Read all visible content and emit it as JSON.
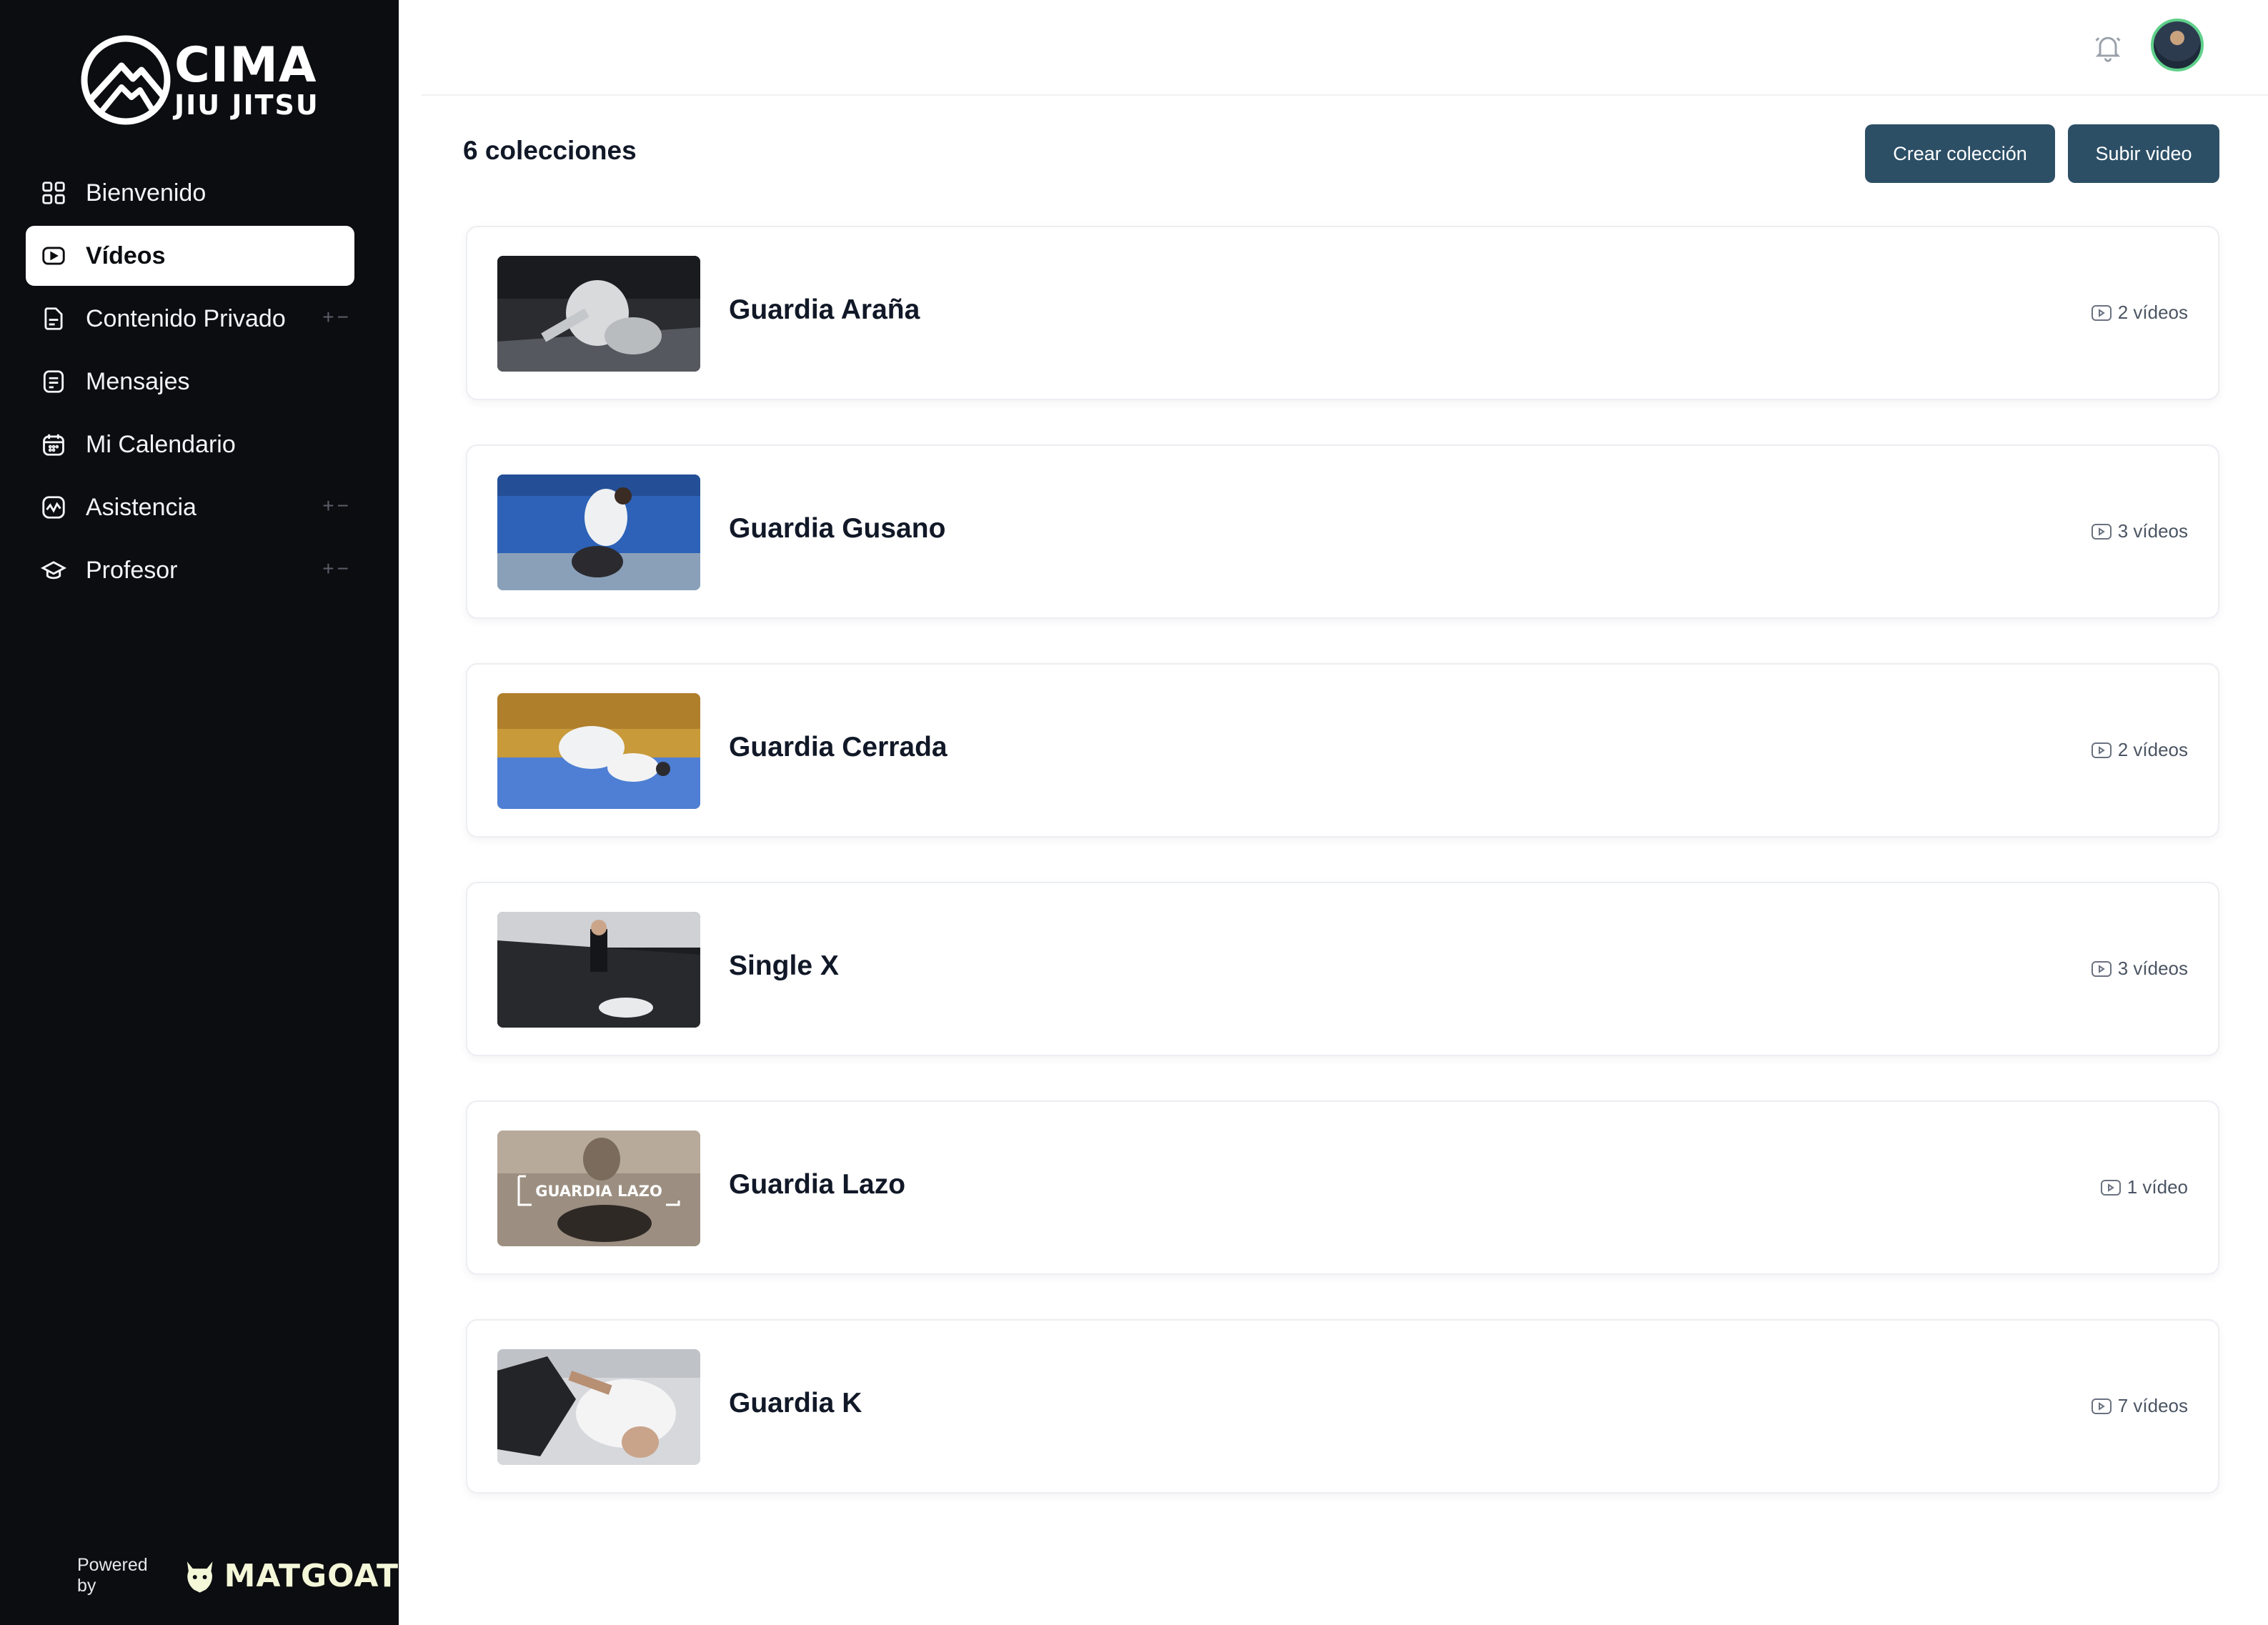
{
  "brand": {
    "line1": "CIMA",
    "line2": "JIU JITSU"
  },
  "sidebar": {
    "items": [
      {
        "label": "Bienvenido",
        "icon": "grid-icon",
        "active": false,
        "expandable": false
      },
      {
        "label": "Vídeos",
        "icon": "video-icon",
        "active": true,
        "expandable": false
      },
      {
        "label": "Contenido Privado",
        "icon": "document-icon",
        "active": false,
        "expandable": true
      },
      {
        "label": "Mensajes",
        "icon": "message-icon",
        "active": false,
        "expandable": false
      },
      {
        "label": "Mi Calendario",
        "icon": "calendar-icon",
        "active": false,
        "expandable": false
      },
      {
        "label": "Asistencia",
        "icon": "activity-icon",
        "active": false,
        "expandable": true
      },
      {
        "label": "Profesor",
        "icon": "graduation-cap-icon",
        "active": false,
        "expandable": true
      }
    ],
    "toggle_glyph": "+−"
  },
  "footer": {
    "powered_by": "Powered by",
    "brand": "MATGOAT"
  },
  "header": {
    "title": "6 colecciones",
    "create_label": "Crear colección",
    "upload_label": "Subir video"
  },
  "collections": [
    {
      "title": "Guardia Araña",
      "count": "2 vídeos"
    },
    {
      "title": "Guardia Gusano",
      "count": "3 vídeos"
    },
    {
      "title": "Guardia Cerrada",
      "count": "2 vídeos"
    },
    {
      "title": "Single X",
      "count": "3 vídeos"
    },
    {
      "title": "Guardia Lazo",
      "count": "1 vídeo",
      "thumb_text": "GUARDIA LAZO"
    },
    {
      "title": "Guardia K",
      "count": "7 vídeos"
    }
  ],
  "colors": {
    "sidebar_bg": "#0c0d11",
    "button_bg": "#2c4f66",
    "accent_green": "#5fd08a"
  }
}
